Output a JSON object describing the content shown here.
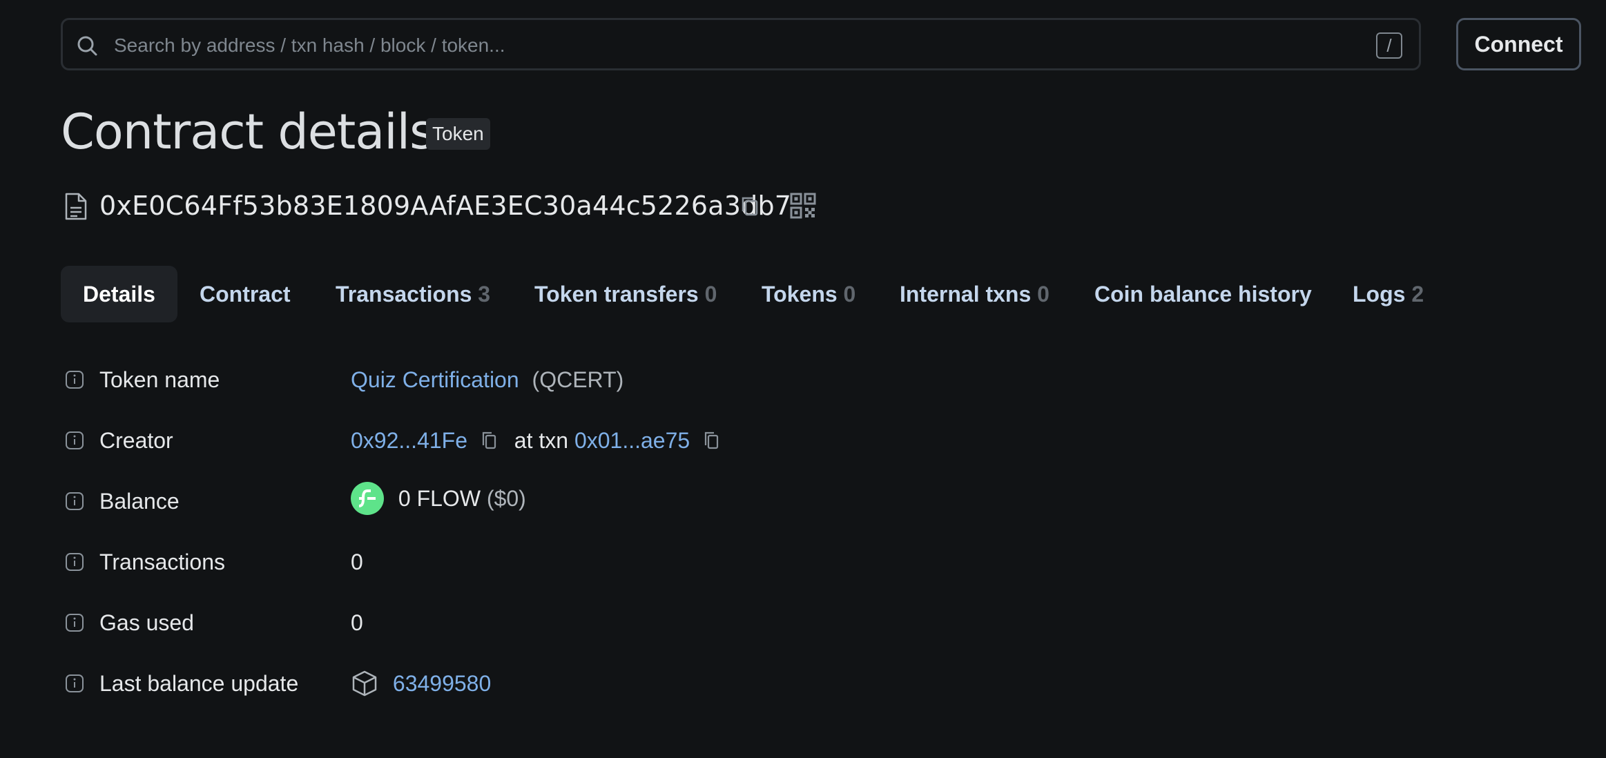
{
  "search": {
    "placeholder": "Search by address / txn hash / block / token...",
    "shortcut": "/"
  },
  "header": {
    "connect_label": "Connect"
  },
  "page": {
    "title": "Contract details",
    "badge": "Token"
  },
  "contract": {
    "address": "0xE0C64Ff53b83E1809AAfAE3EC30a44c5226a3db7"
  },
  "tabs": [
    {
      "label": "Details",
      "count": ""
    },
    {
      "label": "Contract",
      "count": ""
    },
    {
      "label": "Transactions",
      "count": "3"
    },
    {
      "label": "Token transfers",
      "count": "0"
    },
    {
      "label": "Tokens",
      "count": "0"
    },
    {
      "label": "Internal txns",
      "count": "0"
    },
    {
      "label": "Coin balance history",
      "count": ""
    },
    {
      "label": "Logs",
      "count": "2"
    }
  ],
  "details": {
    "token_name": {
      "label": "Token name",
      "name": "Quiz Certification",
      "symbol": "(QCERT)"
    },
    "creator": {
      "label": "Creator",
      "address": "0x92...41Fe",
      "at_txn": "at txn",
      "txn": "0x01...ae75"
    },
    "balance": {
      "label": "Balance",
      "amount": "0 FLOW",
      "usd": "($0)"
    },
    "transactions": {
      "label": "Transactions",
      "value": "0"
    },
    "gas_used": {
      "label": "Gas used",
      "value": "0"
    },
    "last_balance_update": {
      "label": "Last balance update",
      "block": "63499580"
    }
  },
  "colors": {
    "background": "#111315",
    "link": "#7fb0e8",
    "flow_icon": "#5ee38a"
  }
}
